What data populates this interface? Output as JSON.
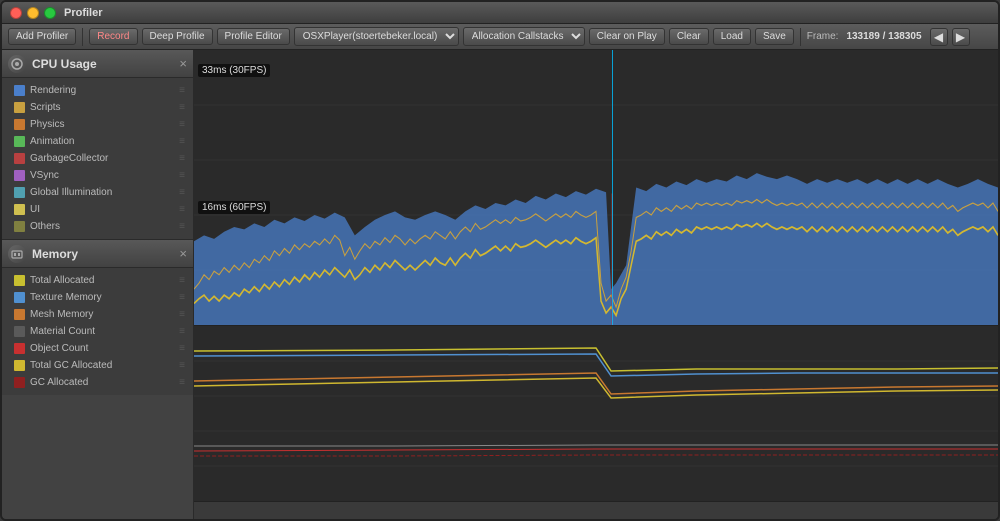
{
  "window": {
    "title": "Profiler"
  },
  "toolbar": {
    "add_profiler_label": "Add Profiler",
    "record_label": "Record",
    "deep_profile_label": "Deep Profile",
    "profile_editor_label": "Profile Editor",
    "target_value": "OSXPlayer(stoertebeker.local)",
    "allocation_label": "Allocation Callstacks",
    "clear_on_play_label": "Clear on Play",
    "clear_label": "Clear",
    "load_label": "Load",
    "save_label": "Save",
    "frame_label": "Frame:",
    "frame_value": "133189 / 138305",
    "nav_prev": "◀",
    "nav_next": "▶"
  },
  "cpu_section": {
    "title": "CPU Usage",
    "close": "×",
    "labels": {
      "fps30": "33ms (30FPS)",
      "fps60": "16ms (60FPS)"
    },
    "legend": [
      {
        "id": "rendering",
        "label": "Rendering",
        "color": "#4a7fcb"
      },
      {
        "id": "scripts",
        "label": "Scripts",
        "color": "#c8a040"
      },
      {
        "id": "physics",
        "label": "Physics",
        "color": "#c87830"
      },
      {
        "id": "animation",
        "label": "Animation",
        "color": "#58b858"
      },
      {
        "id": "gc",
        "label": "GarbageCollector",
        "color": "#b84040"
      },
      {
        "id": "vsync",
        "label": "VSync",
        "color": "#a060c0"
      },
      {
        "id": "gi",
        "label": "Global Illumination",
        "color": "#50a0b0"
      },
      {
        "id": "ui",
        "label": "UI",
        "color": "#d0c050"
      },
      {
        "id": "others",
        "label": "Others",
        "color": "#808040"
      }
    ]
  },
  "memory_section": {
    "title": "Memory",
    "close": "×",
    "legend": [
      {
        "id": "total-alloc",
        "label": "Total Allocated",
        "color": "#c8c030"
      },
      {
        "id": "texture",
        "label": "Texture Memory",
        "color": "#5090d0"
      },
      {
        "id": "mesh",
        "label": "Mesh Memory",
        "color": "#c87830"
      },
      {
        "id": "material",
        "label": "Material Count",
        "color": "#5a5a5a"
      },
      {
        "id": "object",
        "label": "Object Count",
        "color": "#c83030"
      },
      {
        "id": "gc-total",
        "label": "Total GC Allocated",
        "color": "#d0b830"
      },
      {
        "id": "gc",
        "label": "GC Allocated",
        "color": "#902020"
      }
    ]
  }
}
